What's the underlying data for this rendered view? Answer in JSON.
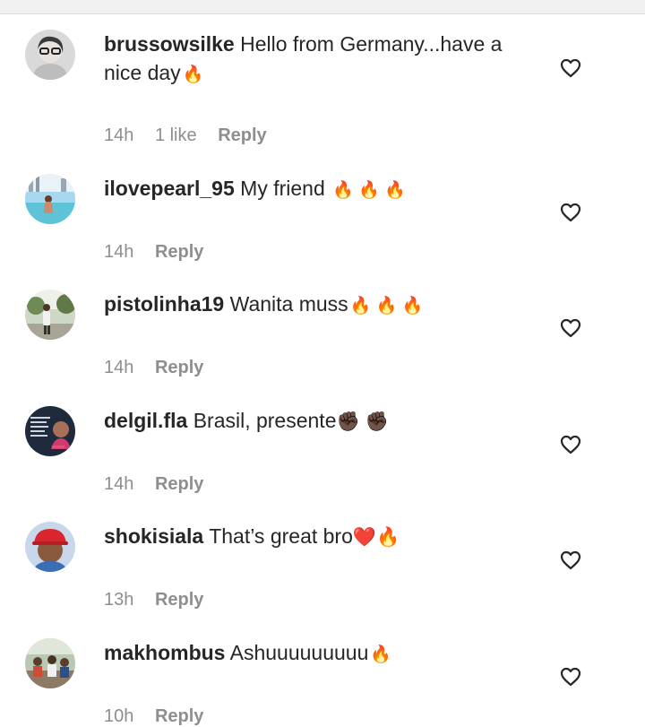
{
  "comments": [
    {
      "username": "brussowsilke",
      "text": "Hello from Germany...have a nice day",
      "emoji": "🔥",
      "time": "14h",
      "likes": "1 like",
      "reply": "Reply",
      "avatar_icon": "avatar-woman-glasses"
    },
    {
      "username": "ilovepearl_95",
      "text": "My friend",
      "emoji": "🔥 🔥 🔥",
      "time": "14h",
      "reply": "Reply",
      "avatar_icon": "avatar-pool"
    },
    {
      "username": "pistolinha19",
      "text": "Wanita muss",
      "emoji": "🔥 🔥 🔥",
      "time": "14h",
      "reply": "Reply",
      "avatar_icon": "avatar-outdoor"
    },
    {
      "username": "delgil.fla",
      "text": "Brasil, presente",
      "emoji": "✊🏿 ✊🏿",
      "time": "14h",
      "reply": "Reply",
      "avatar_icon": "avatar-poster"
    },
    {
      "username": "shokisiala",
      "text": "That’s great bro",
      "emoji": "❤️🔥",
      "time": "13h",
      "reply": "Reply",
      "avatar_icon": "avatar-red-cap"
    },
    {
      "username": "makhombus",
      "text": "Ashuuuuuuuuu",
      "emoji": "🔥",
      "time": "10h",
      "reply": "Reply",
      "avatar_icon": "avatar-group"
    }
  ],
  "colors": {
    "text": "#262626",
    "secondary": "#8e8e8e",
    "topbar": "#f1f1f1"
  },
  "icons": {
    "like": "heart-outline-icon"
  }
}
